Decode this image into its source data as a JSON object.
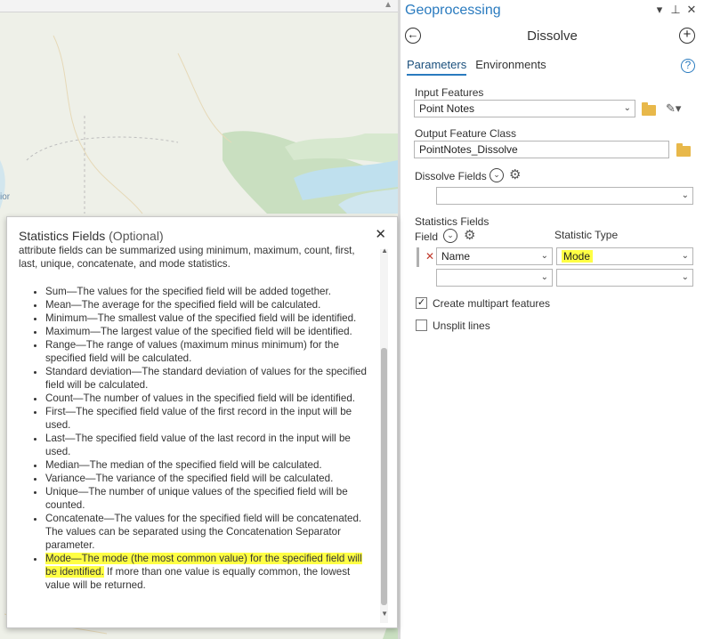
{
  "pane": {
    "title": "Geoprocessing",
    "tool_name": "Dissolve",
    "tabs": [
      {
        "label": "Parameters",
        "active": true
      },
      {
        "label": "Environments",
        "active": false
      }
    ]
  },
  "params": {
    "input_features_label": "Input Features",
    "input_features_value": "Point Notes",
    "output_label": "Output Feature Class",
    "output_value": "PointNotes_Dissolve",
    "dissolve_fields_label": "Dissolve Fields",
    "dissolve_fields_value": "",
    "statistics_fields_label": "Statistics Fields",
    "field_column_label": "Field",
    "statistic_type_label": "Statistic Type",
    "stats_rows": [
      {
        "field": "Name",
        "statistic": "Mode"
      },
      {
        "field": "",
        "statistic": ""
      }
    ],
    "create_multipart_label": "Create multipart features",
    "create_multipart_checked": true,
    "unsplit_lines_label": "Unsplit lines",
    "unsplit_lines_checked": false
  },
  "map": {
    "label_fragment": "ior"
  },
  "popup": {
    "title": "Statistics Fields",
    "optional": "(Optional)",
    "intro": "attribute fields can be summarized using minimum, maximum, count, first, last, unique, concatenate, and mode statistics.",
    "items": [
      "Sum—The values for the specified field will be added together.",
      "Mean—The average for the specified field will be calculated.",
      "Minimum—The smallest value of the specified field will be identified.",
      "Maximum—The largest value of the specified field will be identified.",
      "Range—The range of values (maximum minus minimum) for the specified field will be calculated.",
      "Standard deviation—The standard deviation of values for the specified field will be calculated.",
      "Count—The number of values in the specified field will be identified.",
      "First—The specified field value of the first record in the input will be used.",
      "Last—The specified field value of the last record in the input will be used.",
      "Median—The median of the specified field will be calculated.",
      "Variance—The variance of the specified field will be calculated.",
      "Unique—The number of unique values of the specified field will be counted.",
      "Concatenate—The values for the specified field will be concatenated. The values can be separated using the Concatenation Separator parameter."
    ],
    "mode_highlighted": "Mode—The mode (the most common value) for the specified field will be identified.",
    "mode_rest": " If more than one value is equally common, the lowest value will be returned."
  },
  "colors": {
    "accent": "#2a7bbf",
    "highlight": "#ffff44",
    "remove_x": "#c0392b"
  }
}
